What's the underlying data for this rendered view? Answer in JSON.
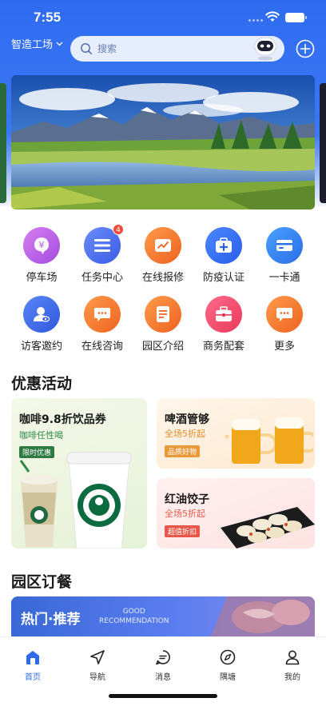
{
  "status_bar": {
    "time": "7:55"
  },
  "header": {
    "location": "智造工场",
    "search_placeholder": "搜索"
  },
  "services": [
    {
      "label": "停车场",
      "icon": "parking-icon",
      "color": "#b35de0"
    },
    {
      "label": "任务中心",
      "icon": "task-list-icon",
      "color": "#4a6ef0",
      "badge": "4"
    },
    {
      "label": "在线报修",
      "icon": "repair-chart-icon",
      "color": "#f07a2a"
    },
    {
      "label": "防疫认证",
      "icon": "medical-kit-icon",
      "color": "#2f6bf0"
    },
    {
      "label": "一卡通",
      "icon": "card-icon",
      "color": "#2f7ff0"
    },
    {
      "label": "访客邀约",
      "icon": "visitor-icon",
      "color": "#3a66e6"
    },
    {
      "label": "在线咨询",
      "icon": "chat-icon",
      "color": "#f07a2a"
    },
    {
      "label": "园区介绍",
      "icon": "document-icon",
      "color": "#f07a2a"
    },
    {
      "label": "商务配套",
      "icon": "briefcase-icon",
      "color": "#ee4a6a"
    },
    {
      "label": "更多",
      "icon": "more-chat-icon",
      "color": "#f07a2a"
    }
  ],
  "promotions": {
    "title": "优惠活动",
    "coffee": {
      "title": "咖啡9.8折饮品券",
      "subtitle": "咖啡任性喝",
      "tag": "限时优惠"
    },
    "beer": {
      "title": "啤酒管够",
      "subtitle": "全场5折起",
      "tag": "品质好物"
    },
    "dumpling": {
      "title": "红油饺子",
      "subtitle": "全场5折起",
      "tag": "超值折扣"
    }
  },
  "dining": {
    "title": "园区订餐",
    "banner_title": "热门·推荐",
    "banner_en_1": "GOOD",
    "banner_en_2": "RECOMMENDATION"
  },
  "tabs": [
    {
      "label": "首页",
      "icon": "home-icon",
      "active": true
    },
    {
      "label": "导航",
      "icon": "navigation-icon"
    },
    {
      "label": "消息",
      "icon": "message-icon"
    },
    {
      "label": "隅塘",
      "icon": "compass-icon"
    },
    {
      "label": "我的",
      "icon": "profile-icon"
    }
  ],
  "colors": {
    "primary": "#2f6bf0",
    "badge": "#f04a3a"
  }
}
